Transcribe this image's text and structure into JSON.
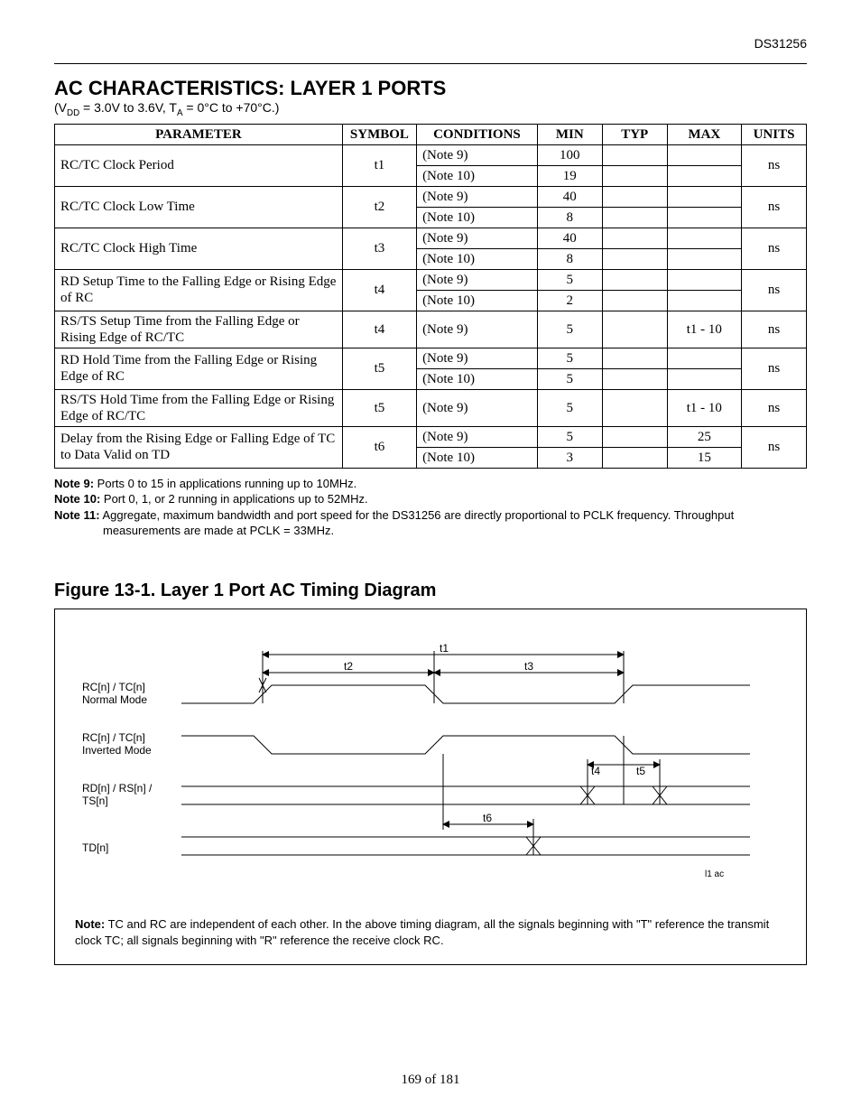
{
  "doc_code": "DS31256",
  "section_title": "AC CHARACTERISTICS: LAYER 1 PORTS",
  "conditions_line": "(V_DD = 3.0V to 3.6V, T_A = 0°C to +70°C.)",
  "table": {
    "headers": {
      "parameter": "PARAMETER",
      "symbol": "SYMBOL",
      "conditions": "CONDITIONS",
      "min": "MIN",
      "typ": "TYP",
      "max": "MAX",
      "units": "UNITS"
    },
    "col_widths": [
      "310",
      "80",
      "130",
      "70",
      "70",
      "80",
      "70"
    ],
    "rows": [
      {
        "param": "RC/TC Clock Period",
        "symbol": "t1",
        "units": "ns",
        "sub": [
          {
            "cond": "(Note 9)",
            "min": "100",
            "typ": "",
            "max": ""
          },
          {
            "cond": "(Note 10)",
            "min": "19",
            "typ": "",
            "max": ""
          }
        ]
      },
      {
        "param": "RC/TC Clock Low Time",
        "symbol": "t2",
        "units": "ns",
        "sub": [
          {
            "cond": "(Note 9)",
            "min": "40",
            "typ": "",
            "max": ""
          },
          {
            "cond": "(Note 10)",
            "min": "8",
            "typ": "",
            "max": ""
          }
        ]
      },
      {
        "param": "RC/TC Clock High Time",
        "symbol": "t3",
        "units": "ns",
        "sub": [
          {
            "cond": "(Note 9)",
            "min": "40",
            "typ": "",
            "max": ""
          },
          {
            "cond": "(Note 10)",
            "min": "8",
            "typ": "",
            "max": ""
          }
        ]
      },
      {
        "param": "RD Setup Time to the Falling Edge or Rising Edge of RC",
        "symbol": "t4",
        "units": "ns",
        "sub": [
          {
            "cond": "(Note 9)",
            "min": "5",
            "typ": "",
            "max": ""
          },
          {
            "cond": "(Note 10)",
            "min": "2",
            "typ": "",
            "max": ""
          }
        ]
      },
      {
        "param": "RS/TS Setup Time from the Falling Edge or Rising Edge of RC/TC",
        "symbol": "t4",
        "units": "ns",
        "sub": [
          {
            "cond": "(Note 9)",
            "min": "5",
            "typ": "",
            "max": "t1 - 10"
          }
        ]
      },
      {
        "param": "RD Hold Time from the Falling Edge or Rising Edge of RC",
        "symbol": "t5",
        "units": "ns",
        "sub": [
          {
            "cond": "(Note 9)",
            "min": "5",
            "typ": "",
            "max": ""
          },
          {
            "cond": "(Note 10)",
            "min": "5",
            "typ": "",
            "max": ""
          }
        ]
      },
      {
        "param": "RS/TS Hold Time from the Falling Edge or Rising Edge of RC/TC",
        "symbol": "t5",
        "units": "ns",
        "sub": [
          {
            "cond": "(Note 9)",
            "min": "5",
            "typ": "",
            "max": "t1 - 10"
          }
        ]
      },
      {
        "param": "Delay from the Rising Edge or Falling Edge of TC to Data Valid on TD",
        "symbol": "t6",
        "units": "ns",
        "sub": [
          {
            "cond": "(Note 9)",
            "min": "5",
            "typ": "",
            "max": "25"
          },
          {
            "cond": "(Note 10)",
            "min": "3",
            "typ": "",
            "max": "15"
          }
        ]
      }
    ]
  },
  "notes": [
    {
      "label": "Note 9:",
      "text": " Ports 0 to 15 in applications running up to 10MHz."
    },
    {
      "label": "Note 10:",
      "text": " Port 0, 1, or 2 running in applications up to 52MHz."
    },
    {
      "label": "Note 11:",
      "text": " Aggregate, maximum bandwidth and port speed for the DS31256 are directly proportional to PCLK frequency. Throughput",
      "cont": "measurements are made at PCLK = 33MHz."
    }
  ],
  "figure_title": "Figure 13-1. Layer 1 Port AC Timing Diagram",
  "timing_labels": {
    "sig1": "RC[n] / TC[n]\nNormal Mode",
    "sig2": "RC[n] / TC[n]\nInverted Mode",
    "sig3": "RD[n] / RS[n] /\nTS[n]",
    "sig4": "TD[n]",
    "t1": "t1",
    "t2": "t2",
    "t3": "t3",
    "t4": "t4",
    "t5": "t5",
    "t6": "t6",
    "corner": "l1 ac"
  },
  "figure_note_label": "Note:",
  "figure_note": " TC and RC are independent of each other. In the above timing diagram, all the signals beginning with \"T\" reference the transmit clock TC; all signals beginning with \"R\" reference the receive clock RC.",
  "page_number": "169 of 181"
}
